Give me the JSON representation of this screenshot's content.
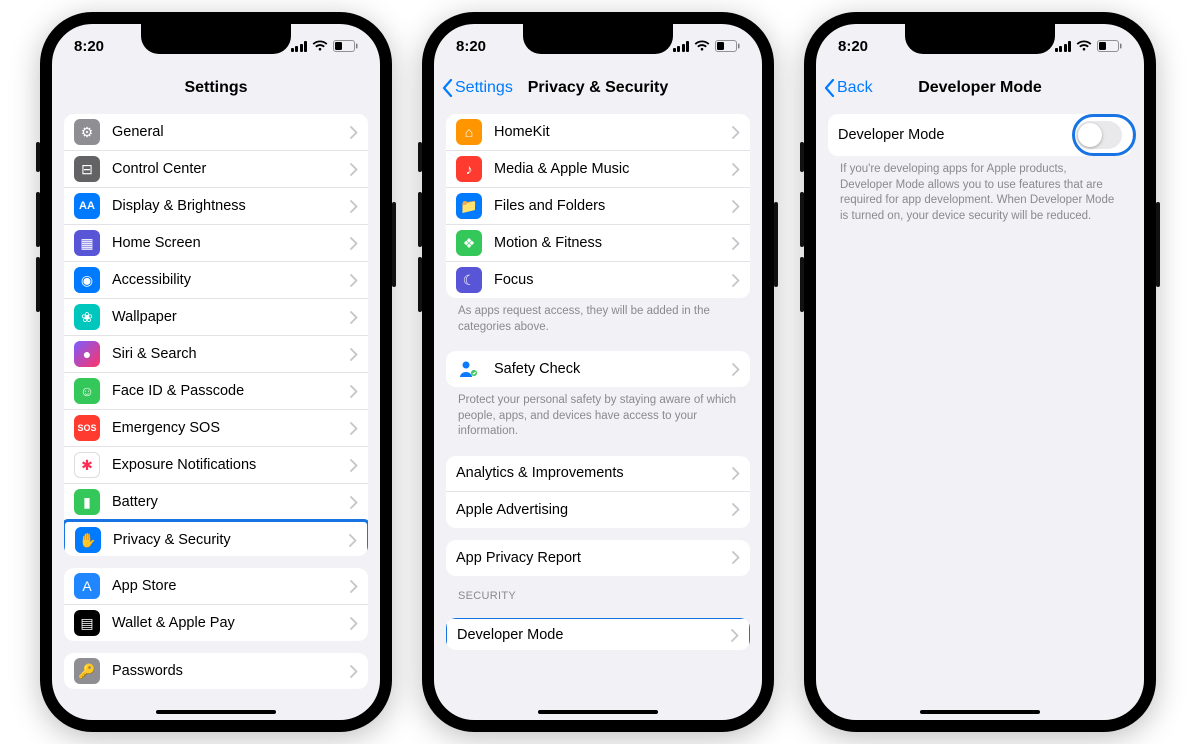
{
  "status": {
    "time": "8:20"
  },
  "screen1": {
    "title": "Settings",
    "group1": [
      {
        "icon": "gear-icon",
        "label": "General",
        "cls": "ic-gray"
      },
      {
        "icon": "control-center-icon",
        "label": "Control Center",
        "cls": "ic-darkgray"
      },
      {
        "icon": "display-icon",
        "label": "Display & Brightness",
        "cls": "ic-blue"
      },
      {
        "icon": "home-screen-icon",
        "label": "Home Screen",
        "cls": "ic-indigo"
      },
      {
        "icon": "accessibility-icon",
        "label": "Accessibility",
        "cls": "ic-blue"
      },
      {
        "icon": "wallpaper-icon",
        "label": "Wallpaper",
        "cls": "ic-teal"
      },
      {
        "icon": "siri-icon",
        "label": "Siri & Search",
        "cls": "ic-black"
      },
      {
        "icon": "faceid-icon",
        "label": "Face ID & Passcode",
        "cls": "ic-green"
      },
      {
        "icon": "sos-icon",
        "label": "Emergency SOS",
        "cls": "ic-red"
      },
      {
        "icon": "exposure-icon",
        "label": "Exposure Notifications",
        "cls": "ic-white"
      },
      {
        "icon": "battery-icon",
        "label": "Battery",
        "cls": "ic-green"
      },
      {
        "icon": "privacy-icon",
        "label": "Privacy & Security",
        "cls": "ic-blue",
        "highlight": true
      }
    ],
    "group2": [
      {
        "icon": "appstore-icon",
        "label": "App Store",
        "cls": "ic-appstore"
      },
      {
        "icon": "wallet-icon",
        "label": "Wallet & Apple Pay",
        "cls": "ic-wallet"
      }
    ],
    "group3": [
      {
        "icon": "passwords-icon",
        "label": "Passwords",
        "cls": "ic-gray"
      }
    ]
  },
  "screen2": {
    "back": "Settings",
    "title": "Privacy & Security",
    "group1": [
      {
        "icon": "homekit-icon",
        "label": "HomeKit",
        "cls": "ic-orange"
      },
      {
        "icon": "music-icon",
        "label": "Media & Apple Music",
        "cls": "ic-red"
      },
      {
        "icon": "files-icon",
        "label": "Files and Folders",
        "cls": "ic-blue"
      },
      {
        "icon": "motion-icon",
        "label": "Motion & Fitness",
        "cls": "ic-green"
      },
      {
        "icon": "focus-icon",
        "label": "Focus",
        "cls": "ic-indigo"
      }
    ],
    "footer1": "As apps request access, they will be added in the categories above.",
    "group2": [
      {
        "icon": "safety-icon",
        "label": "Safety Check",
        "cls": ""
      }
    ],
    "footer2": "Protect your personal safety by staying aware of which people, apps, and devices have access to your information.",
    "group3": [
      {
        "label": "Analytics & Improvements"
      },
      {
        "label": "Apple Advertising"
      }
    ],
    "group4": [
      {
        "label": "App Privacy Report"
      }
    ],
    "section_security": "SECURITY",
    "group5": [
      {
        "label": "Developer Mode",
        "highlight": true
      }
    ]
  },
  "screen3": {
    "back": "Back",
    "title": "Developer Mode",
    "row_label": "Developer Mode",
    "footer": "If you're developing apps for Apple products, Developer Mode allows you to use features that are required for app development. When Developer Mode is turned on, your device security will be reduced."
  }
}
